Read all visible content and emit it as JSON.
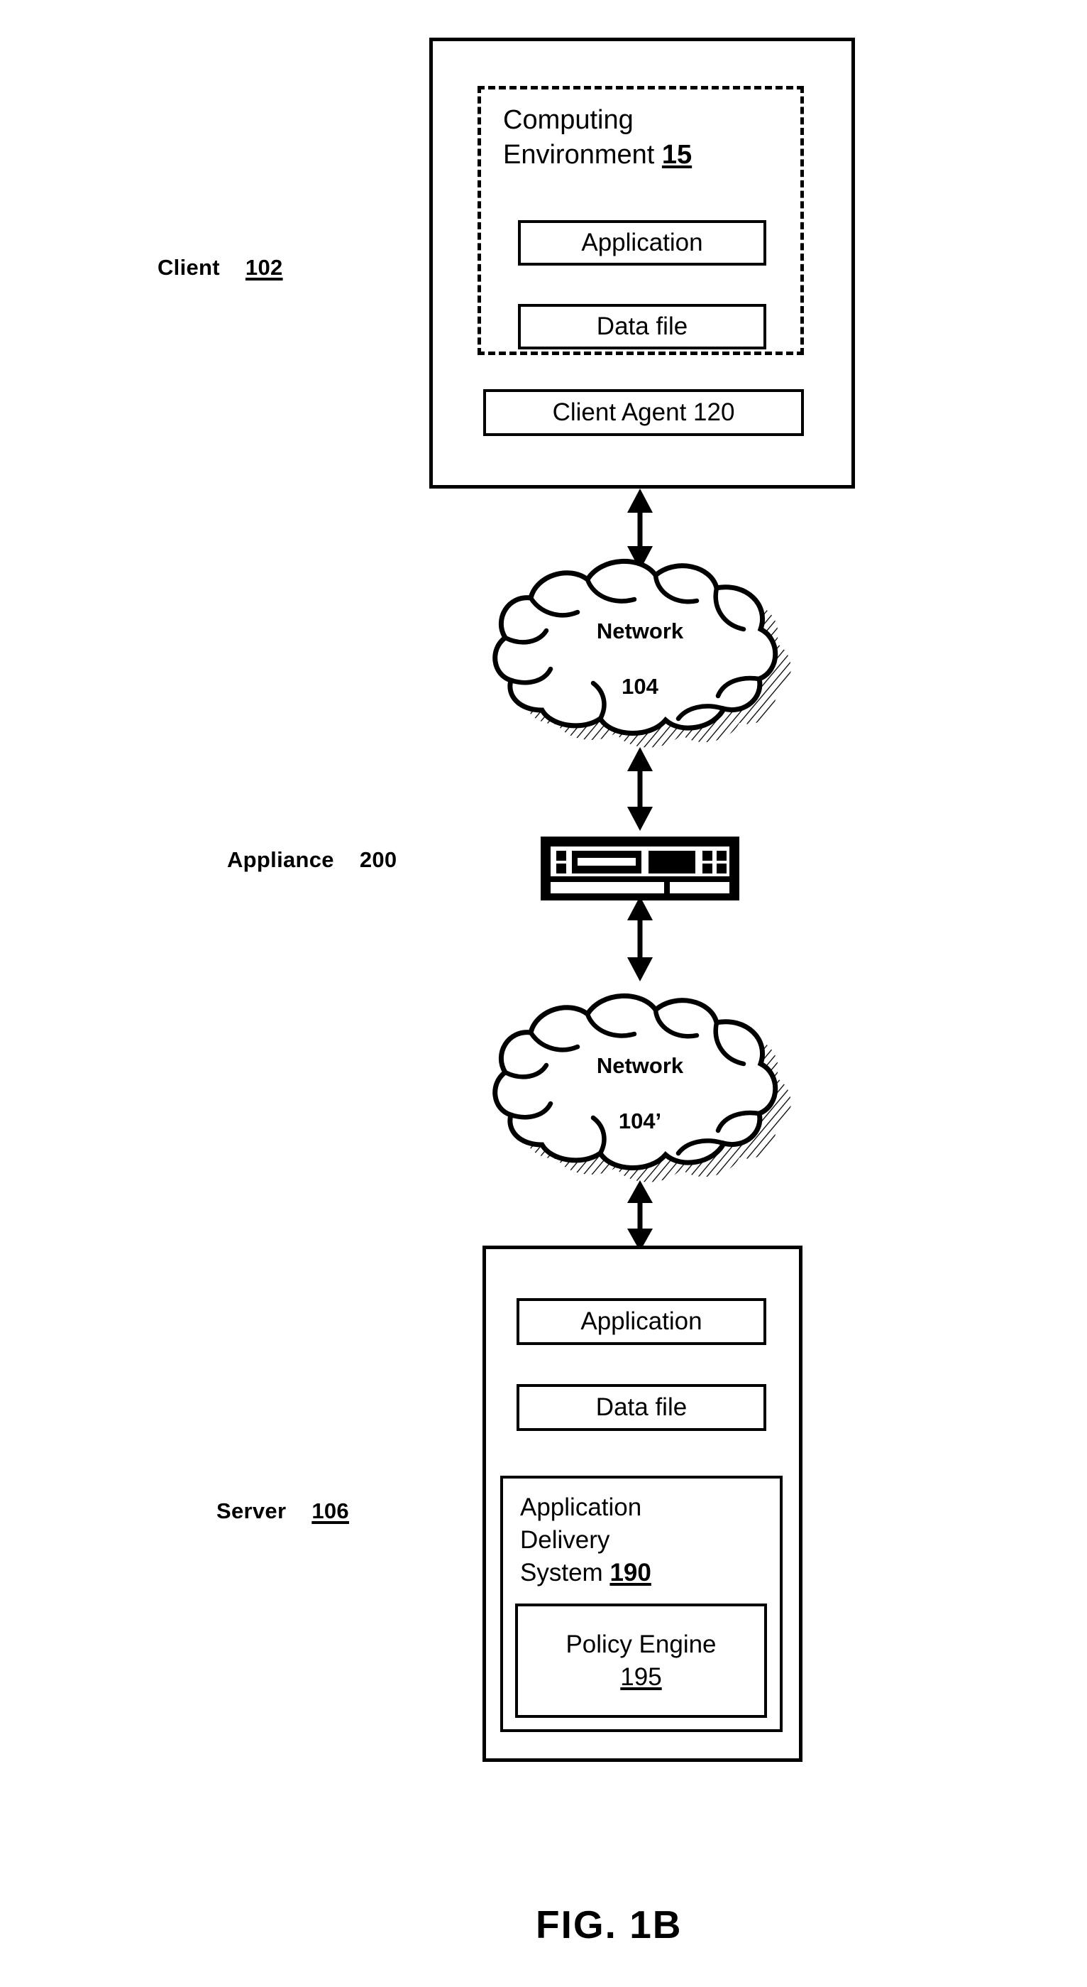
{
  "figure": {
    "caption": "FIG. 1B",
    "type": "network-architecture-diagram"
  },
  "client": {
    "side_label": "Client",
    "side_number": "102",
    "computing_environment": {
      "label_line1": "Computing",
      "label_line2": "Environment",
      "number": "15"
    },
    "application_box": "Application",
    "data_file_box": "Data file",
    "client_agent_box": "Client Agent 120"
  },
  "network_top": {
    "name": "Network",
    "number": "104"
  },
  "appliance": {
    "side_label": "Appliance",
    "side_number": "200",
    "icon": "appliance-device-icon"
  },
  "network_bottom": {
    "name": "Network",
    "number": "104’"
  },
  "server": {
    "side_label": "Server",
    "side_number": "106",
    "application_box": "Application",
    "data_file_box": "Data file",
    "application_delivery_system": {
      "line1": "Application",
      "line2": "Delivery",
      "line3": "System",
      "number": "190"
    },
    "policy_engine": {
      "label": "Policy Engine",
      "number": "195"
    }
  },
  "connectors": {
    "client_to_network": "double-headed-arrow",
    "network_to_appliance": "double-headed-arrow",
    "appliance_to_network2": "double-headed-arrow",
    "network2_to_server": "double-headed-arrow"
  },
  "colors": {
    "stroke": "#000000",
    "background": "#ffffff"
  }
}
